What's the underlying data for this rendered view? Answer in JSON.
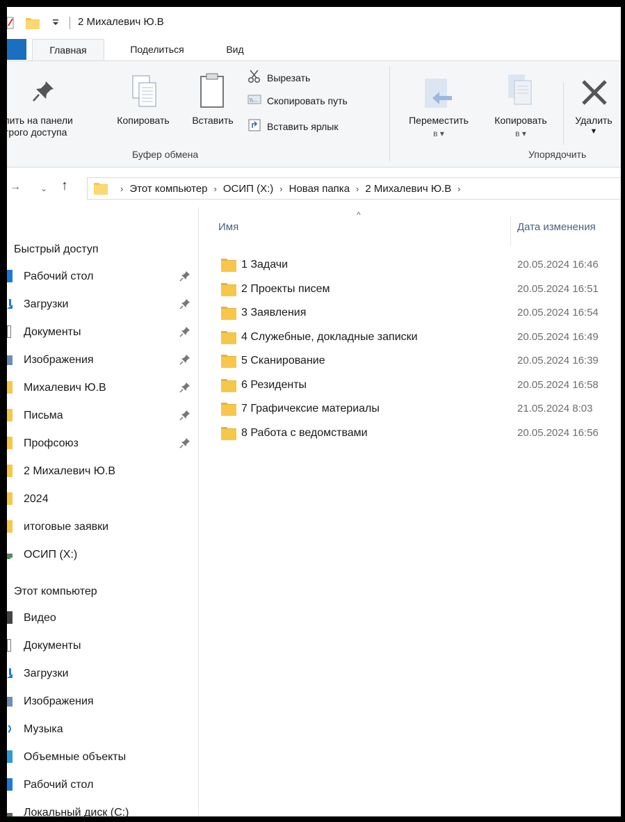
{
  "window": {
    "title": "2 Михалевич Ю.В"
  },
  "ribbon_tabs": [
    "Главная",
    "Поделиться",
    "Вид"
  ],
  "ribbon": {
    "pin_line1": "пить на панели",
    "pin_line2": "трого доступа",
    "copy": "Копировать",
    "paste": "Вставить",
    "cut": "Вырезать",
    "copy_path": "Скопировать путь",
    "paste_shortcut": "Вставить ярлык",
    "clipboard_group": "Буфер обмена",
    "move_to": "Переместить",
    "move_to_sub": "в",
    "copy_to": "Копировать",
    "copy_to_sub": "в",
    "delete": "Удалить",
    "organize_group": "Упорядочить"
  },
  "address": {
    "crumbs": [
      "Этот компьютер",
      "ОСИП (X:)",
      "Новая папка",
      "2 Михалевич Ю.В"
    ]
  },
  "nav": {
    "quick_access": "Быстрый доступ",
    "quick_items": [
      {
        "label": "Рабочий стол",
        "pinned": true
      },
      {
        "label": "Загрузки",
        "pinned": true
      },
      {
        "label": "Документы",
        "pinned": true
      },
      {
        "label": "Изображения",
        "pinned": true
      },
      {
        "label": "Михалевич Ю.В",
        "pinned": true
      },
      {
        "label": "Письма",
        "pinned": true
      },
      {
        "label": "Профсоюз",
        "pinned": true
      },
      {
        "label": "2 Михалевич Ю.В",
        "pinned": false
      },
      {
        "label": "2024",
        "pinned": false
      },
      {
        "label": "итоговые заявки",
        "pinned": false
      },
      {
        "label": "ОСИП (X:)",
        "pinned": false
      }
    ],
    "this_pc": "Этот компьютер",
    "pc_items": [
      {
        "label": "Видео"
      },
      {
        "label": "Документы"
      },
      {
        "label": "Загрузки"
      },
      {
        "label": "Изображения"
      },
      {
        "label": "Музыка"
      },
      {
        "label": "Объемные объекты"
      },
      {
        "label": "Рабочий стол"
      },
      {
        "label": "Локальный диск (C:)"
      }
    ]
  },
  "files": {
    "col_name": "Имя",
    "col_date": "Дата изменения",
    "rows": [
      {
        "name": "1 Задачи",
        "date": "20.05.2024 16:46"
      },
      {
        "name": "2 Проекты писем",
        "date": "20.05.2024 16:51"
      },
      {
        "name": "3 Заявления",
        "date": "20.05.2024 16:54"
      },
      {
        "name": "4 Служебные, докладные записки",
        "date": "20.05.2024 16:49"
      },
      {
        "name": "5 Сканирование",
        "date": "20.05.2024 16:39"
      },
      {
        "name": "6 Резиденты",
        "date": "20.05.2024 16:58"
      },
      {
        "name": "7 Графичексие материалы",
        "date": "21.05.2024 8:03"
      },
      {
        "name": "8 Работа с ведомствами",
        "date": "20.05.2024 16:56"
      }
    ]
  },
  "colors": {
    "accent": "#1a6fc0",
    "folder": "#f7c74a",
    "ribbon_bg": "#f5f6f7"
  }
}
